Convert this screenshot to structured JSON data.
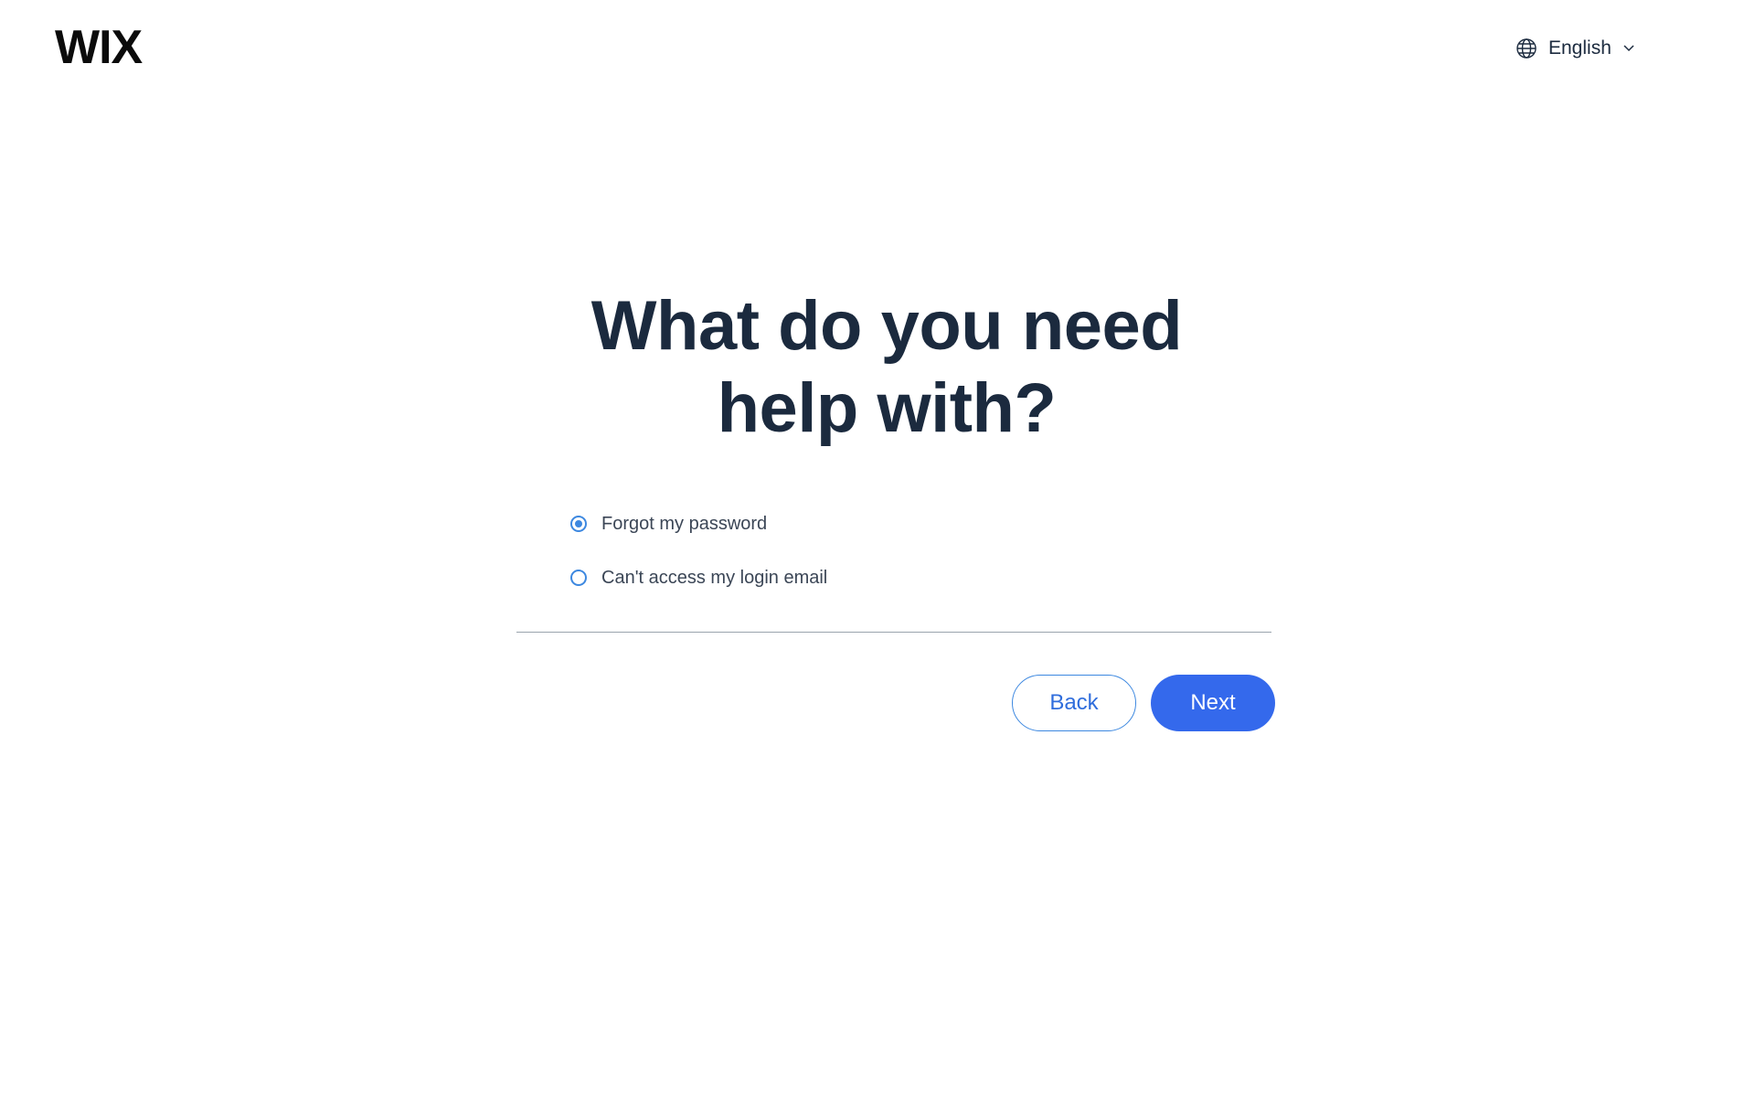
{
  "header": {
    "logo_text": "WIX",
    "language": {
      "icon": "globe-icon",
      "selected": "English",
      "dropdown_icon": "chevron-down-icon"
    }
  },
  "main": {
    "title": "What do you need help with?",
    "options": [
      {
        "label": "Forgot my password",
        "selected": true
      },
      {
        "label": "Can't access my login email",
        "selected": false
      }
    ],
    "buttons": {
      "back_label": "Back",
      "next_label": "Next"
    }
  },
  "colors": {
    "accent": "#3469ec",
    "radio": "#3d88e0",
    "title": "#1b2a3e"
  }
}
